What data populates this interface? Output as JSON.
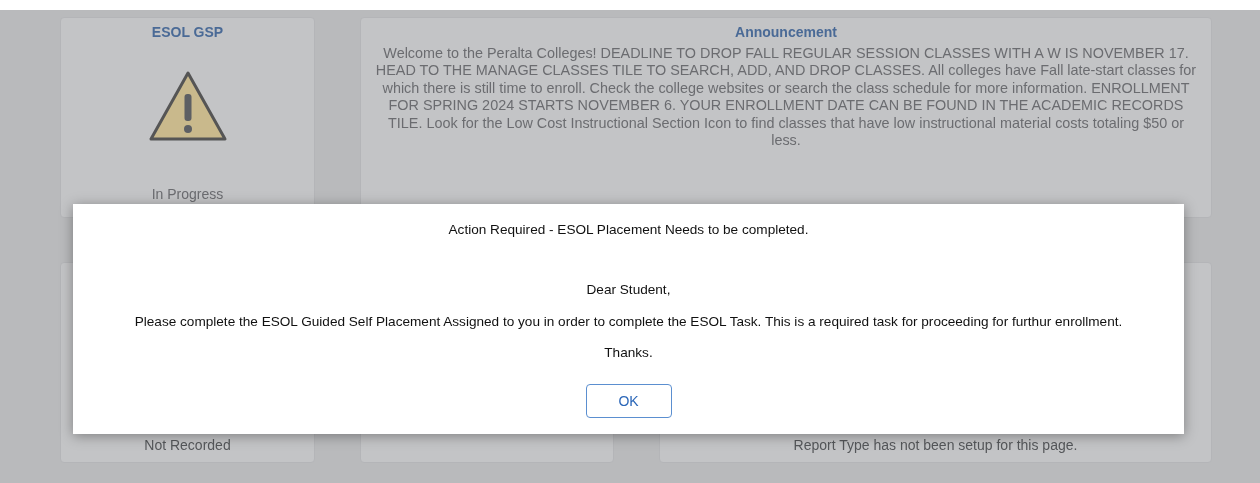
{
  "tiles": [
    {
      "kind": "status",
      "title": "ESOL GSP",
      "status": "In Progress"
    },
    {
      "kind": "text",
      "title": "Announcement",
      "body": "Welcome to the Peralta Colleges! DEADLINE TO DROP FALL REGULAR SESSION CLASSES WITH A W IS NOVEMBER 17. HEAD TO THE MANAGE CLASSES TILE TO SEARCH, ADD, AND DROP CLASSES. All colleges have Fall late-start classes for which there is still time to enroll. Check the college websites or search the class schedule for more information. ENROLLMENT FOR SPRING 2024 STARTS NOVEMBER 6. YOUR ENROLLMENT DATE CAN BE FOUND IN THE ACADEMIC RECORDS TILE. Look for the Low Cost Instructional Section Icon to find classes that have low instructional material costs totaling $50 or less."
    },
    {
      "kind": "footer",
      "footer": "Not Recorded"
    },
    {
      "kind": "footer"
    },
    {
      "kind": "footer",
      "footer": "Report Type has not been setup for this page."
    }
  ],
  "dialog": {
    "title": "Action Required - ESOL Placement Needs to be completed.",
    "greeting": "Dear Student,",
    "message": "Please complete the ESOL Guided Self Placement Assigned to you in order to complete the ESOL Task. This is a required task for proceeding for furthur enrollment.",
    "closing": "Thanks.",
    "button": "OK"
  }
}
